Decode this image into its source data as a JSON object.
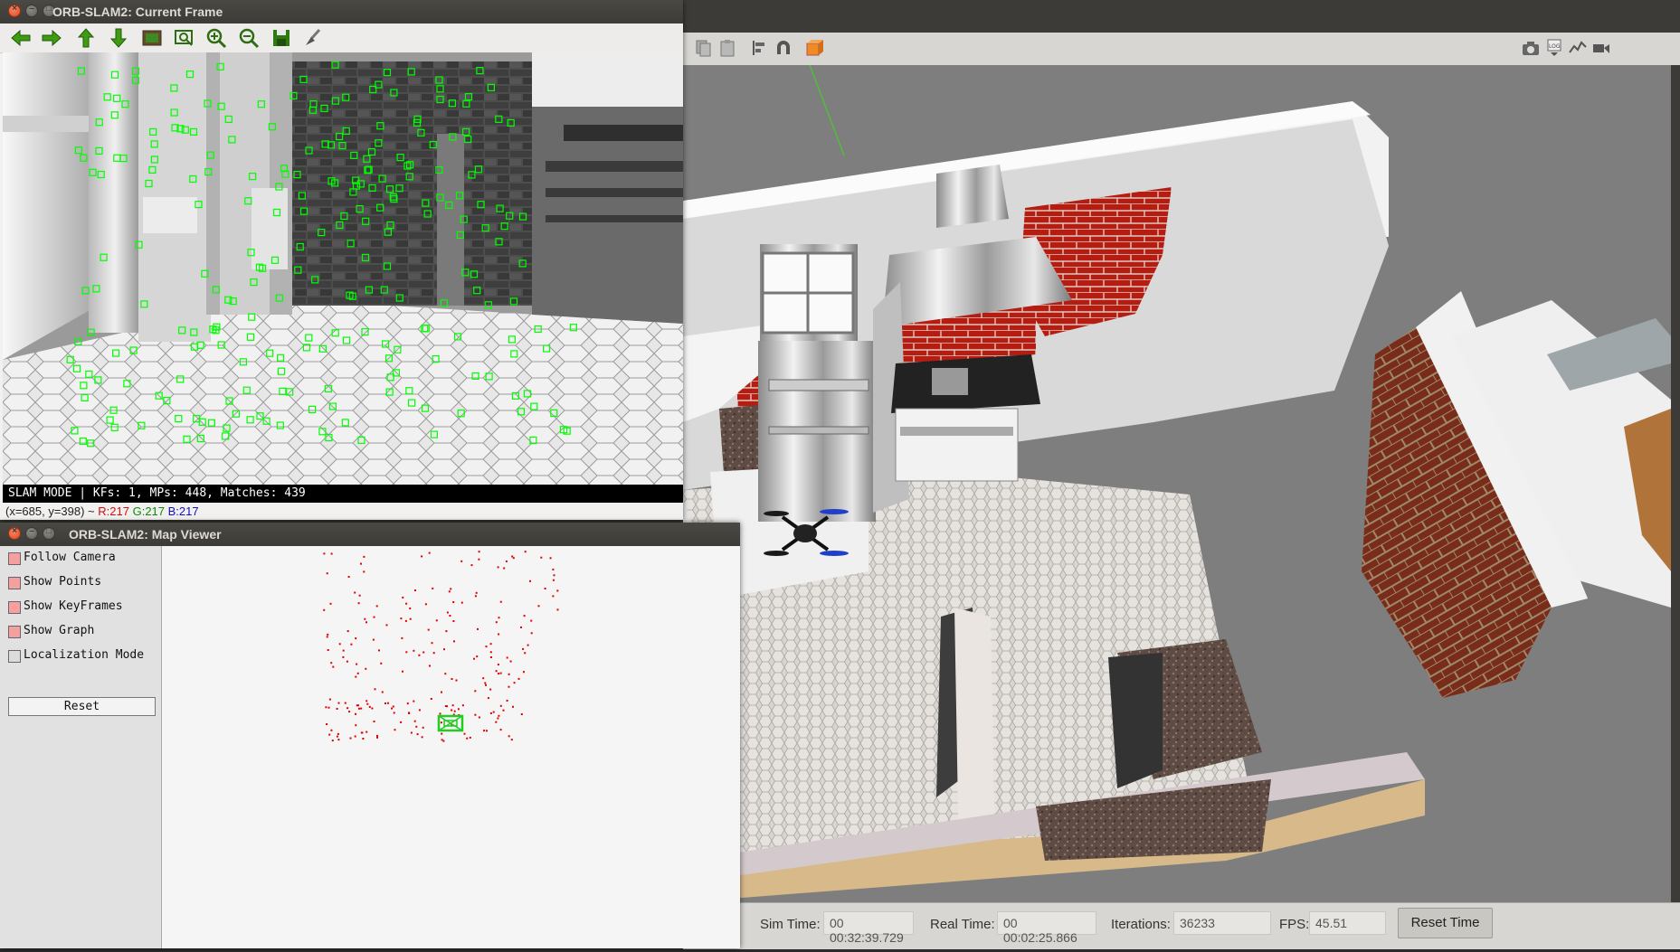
{
  "current_frame": {
    "title": "ORB-SLAM2: Current Frame",
    "toolbar": [
      "back-arrow-icon",
      "forward-arrow-icon",
      "up-arrow-icon",
      "down-arrow-icon",
      "screen-icon",
      "zoom-fit-icon",
      "zoom-in-icon",
      "zoom-out-icon",
      "save-icon",
      "brush-icon"
    ],
    "status": "SLAM MODE |  KFs: 1, MPs: 448, Matches: 439",
    "coords": {
      "prefix": "(x=685, y=398) ~ ",
      "r": "R:217",
      "g": "G:217",
      "b": "B:217"
    }
  },
  "map_viewer": {
    "title": "ORB-SLAM2: Map Viewer",
    "options": [
      {
        "label": "Follow Camera",
        "checked": true
      },
      {
        "label": "Show Points",
        "checked": true
      },
      {
        "label": "Show KeyFrames",
        "checked": true
      },
      {
        "label": "Show Graph",
        "checked": true
      },
      {
        "label": "Localization Mode",
        "checked": false
      }
    ],
    "reset_label": "Reset"
  },
  "gazebo": {
    "toolbar_icons": [
      "copy-icon",
      "paste-icon",
      "align-icon",
      "magnet-icon",
      "view-angle-icon",
      "screenshot-icon",
      "log-icon",
      "plot-icon",
      "video-icon"
    ],
    "bottom": {
      "sim_time_label": "Sim Time:",
      "sim_time": "00 00:32:39.729",
      "real_time_label": "Real Time:",
      "real_time": "00 00:02:25.866",
      "iterations_label": "Iterations:",
      "iterations": "36233",
      "fps_label": "FPS:",
      "fps": "45.51",
      "reset_label": "Reset Time"
    }
  },
  "colors": {
    "feature": "#00ff00",
    "map_point": "#e00000",
    "r": "#d01010",
    "g": "#0a8a0a",
    "b": "#1010c0"
  }
}
